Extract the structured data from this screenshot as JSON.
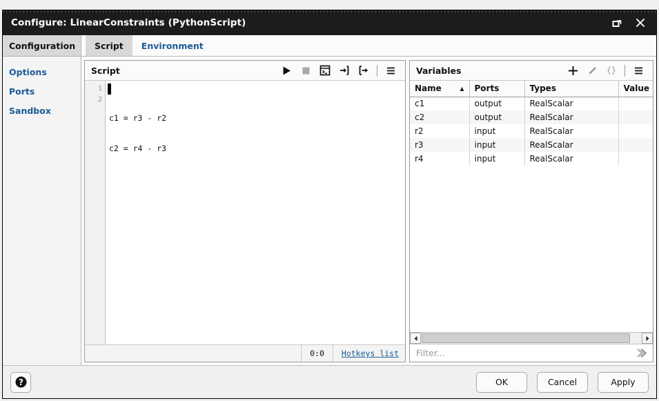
{
  "window": {
    "title": "Configure: LinearConstraints (PythonScript)",
    "controls": [
      {
        "name": "restore-window-button",
        "icon": "restore-icon"
      },
      {
        "name": "close-window-button",
        "icon": "close-icon"
      }
    ]
  },
  "sidebar": {
    "header": "Configuration",
    "items": [
      {
        "label": "Options"
      },
      {
        "label": "Ports"
      },
      {
        "label": "Sandbox"
      }
    ]
  },
  "tabs": [
    {
      "label": "Script",
      "active": true
    },
    {
      "label": "Environment",
      "active": false
    }
  ],
  "script_panel": {
    "title": "Script",
    "toolbar": [
      {
        "name": "run-script-button",
        "icon": "play-icon"
      },
      {
        "name": "stop-script-button",
        "icon": "stop-icon"
      },
      {
        "name": "open-console-button",
        "icon": "console-icon"
      },
      {
        "name": "import-script-button",
        "icon": "import-arrow-icon"
      },
      {
        "name": "export-script-button",
        "icon": "export-arrow-icon"
      },
      {
        "name": "script-menu-button",
        "icon": "hamburger-icon"
      }
    ],
    "code_lines": [
      {
        "number": "1",
        "text": "c1 = r3 - r2"
      },
      {
        "number": "2",
        "text": "c2 = r4 - r3"
      }
    ],
    "status": {
      "cursor_position": "0:0",
      "hotkeys_link": "Hotkeys list"
    }
  },
  "variables_panel": {
    "title": "Variables",
    "toolbar": [
      {
        "name": "add-variable-button",
        "icon": "plus-icon"
      },
      {
        "name": "edit-variable-button",
        "icon": "pencil-icon"
      },
      {
        "name": "braces-button",
        "icon": "braces-icon"
      },
      {
        "name": "variables-menu-button",
        "icon": "hamburger-icon"
      }
    ],
    "columns": [
      "Name",
      "Ports",
      "Types",
      "Value"
    ],
    "sort": {
      "column": "Name",
      "direction": "ascending",
      "glyph": "▲"
    },
    "rows": [
      {
        "name": "c1",
        "ports": "output",
        "types": "RealScalar",
        "value": ""
      },
      {
        "name": "c2",
        "ports": "output",
        "types": "RealScalar",
        "value": ""
      },
      {
        "name": "r2",
        "ports": "input",
        "types": "RealScalar",
        "value": ""
      },
      {
        "name": "r3",
        "ports": "input",
        "types": "RealScalar",
        "value": ""
      },
      {
        "name": "r4",
        "ports": "input",
        "types": "RealScalar",
        "value": ""
      }
    ],
    "filter": {
      "value": "",
      "placeholder": "Filter..."
    }
  },
  "footer": {
    "help_button": "help-icon",
    "buttons": [
      {
        "label": "OK",
        "name": "ok-button"
      },
      {
        "label": "Cancel",
        "name": "cancel-button"
      },
      {
        "label": "Apply",
        "name": "apply-button"
      }
    ]
  },
  "colors": {
    "titlebar": "#1c1c1c",
    "link": "#1a5b96",
    "active_tab": "#d8d8d8",
    "panel_bg": "#ffffff",
    "row_alt": "#f6f6f6"
  }
}
